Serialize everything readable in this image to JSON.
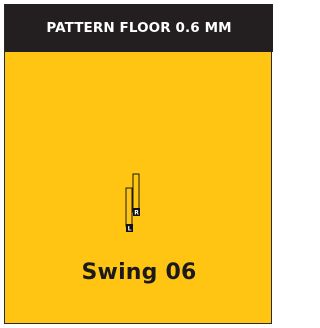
{
  "header": {
    "text": "PATTERN FLOOR 0.6 MM"
  },
  "diagram": {
    "left_foot_label": "L",
    "right_foot_label": "R",
    "outline_color": "#1a1a1a",
    "badge_color": "#111111"
  },
  "title": "Swing 06",
  "colors": {
    "card_background": "#FFC512",
    "header_background": "#231F20",
    "header_text": "#FFFFFF",
    "title_text": "#1A1A1A"
  }
}
